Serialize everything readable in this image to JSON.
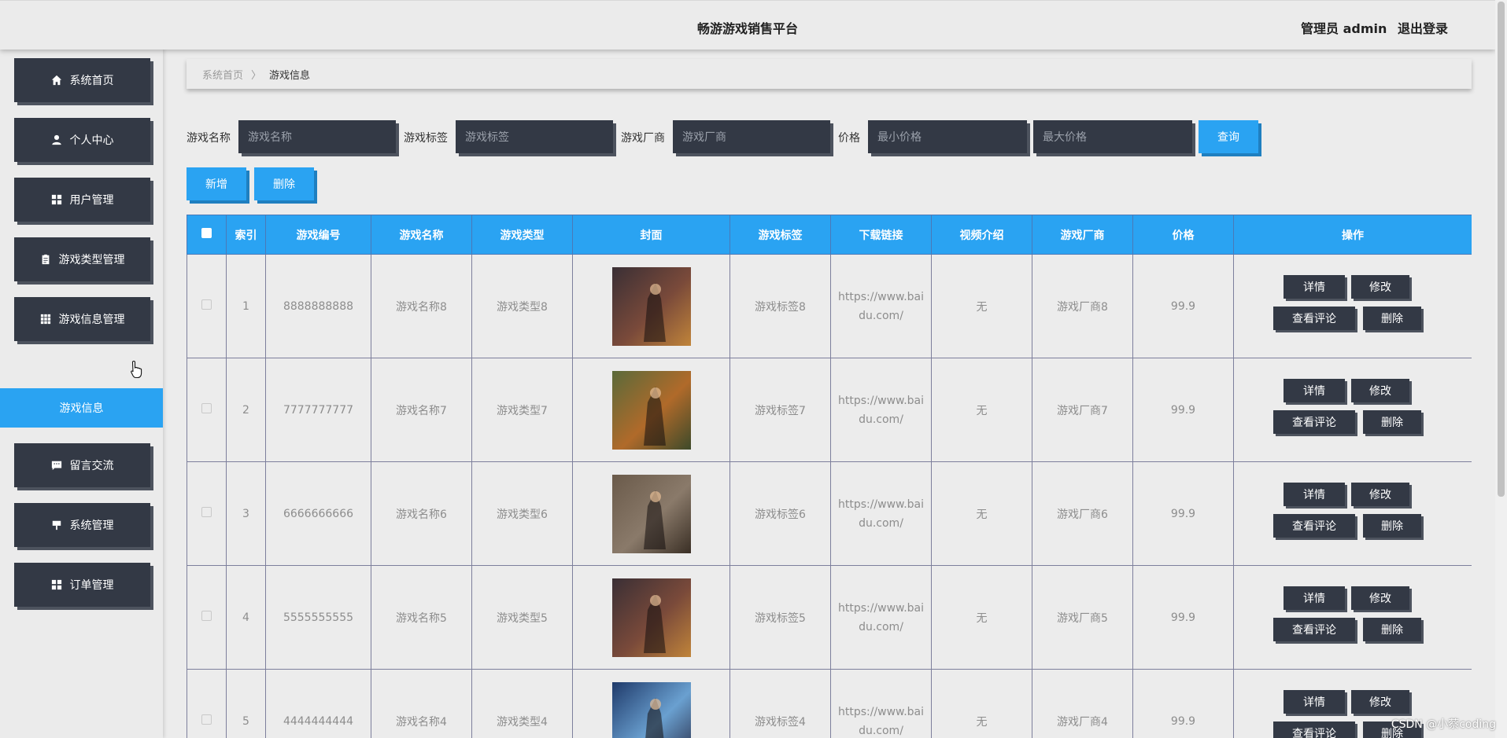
{
  "header": {
    "title": "畅游游戏销售平台",
    "user_label": "管理员 admin",
    "logout_label": "退出登录"
  },
  "sidebar": {
    "items": [
      {
        "label": "系统首页",
        "icon": "home-icon"
      },
      {
        "label": "个人中心",
        "icon": "user-icon"
      },
      {
        "label": "用户管理",
        "icon": "grid-icon"
      },
      {
        "label": "游戏类型管理",
        "icon": "clipboard-icon"
      },
      {
        "label": "游戏信息管理",
        "icon": "apps-icon"
      },
      {
        "label": "留言交流",
        "icon": "chat-icon"
      },
      {
        "label": "系统管理",
        "icon": "sign-icon"
      },
      {
        "label": "订单管理",
        "icon": "grid-icon"
      }
    ],
    "active_sub": "游戏信息"
  },
  "breadcrumb": {
    "home": "系统首页",
    "separator": "〉",
    "current": "游戏信息"
  },
  "search": {
    "name_label": "游戏名称",
    "name_placeholder": "游戏名称",
    "tag_label": "游戏标签",
    "tag_placeholder": "游戏标签",
    "vendor_label": "游戏厂商",
    "vendor_placeholder": "游戏厂商",
    "price_label": "价格",
    "min_placeholder": "最小价格",
    "max_placeholder": "最大价格",
    "query_label": "查询"
  },
  "actions": {
    "add_label": "新增",
    "delete_label": "删除"
  },
  "table": {
    "headers": [
      "索引",
      "游戏编号",
      "游戏名称",
      "游戏类型",
      "封面",
      "游戏标签",
      "下载链接",
      "视频介绍",
      "游戏厂商",
      "价格",
      "操作"
    ],
    "op_labels": {
      "detail": "详情",
      "edit": "修改",
      "comments": "查看评论",
      "delete": "删除"
    },
    "rows": [
      {
        "index": "1",
        "code": "8888888888",
        "name": "游戏名称8",
        "type": "游戏类型8",
        "tag": "游戏标签8",
        "link": "https://www.baidu.com/",
        "video": "无",
        "vendor": "游戏厂商8",
        "price": "99.9"
      },
      {
        "index": "2",
        "code": "7777777777",
        "name": "游戏名称7",
        "type": "游戏类型7",
        "tag": "游戏标签7",
        "link": "https://www.baidu.com/",
        "video": "无",
        "vendor": "游戏厂商7",
        "price": "99.9"
      },
      {
        "index": "3",
        "code": "6666666666",
        "name": "游戏名称6",
        "type": "游戏类型6",
        "tag": "游戏标签6",
        "link": "https://www.baidu.com/",
        "video": "无",
        "vendor": "游戏厂商6",
        "price": "99.9"
      },
      {
        "index": "4",
        "code": "5555555555",
        "name": "游戏名称5",
        "type": "游戏类型5",
        "tag": "游戏标签5",
        "link": "https://www.baidu.com/",
        "video": "无",
        "vendor": "游戏厂商5",
        "price": "99.9"
      },
      {
        "index": "5",
        "code": "4444444444",
        "name": "游戏名称4",
        "type": "游戏类型4",
        "tag": "游戏标签4",
        "link": "https://www.baidu.com/",
        "video": "无",
        "vendor": "游戏厂商4",
        "price": "99.9"
      }
    ]
  },
  "watermark": "CSDN @小蔡coding",
  "colors": {
    "accent": "#2aa3f2",
    "dark_button": "#333945",
    "background": "#ececec"
  }
}
